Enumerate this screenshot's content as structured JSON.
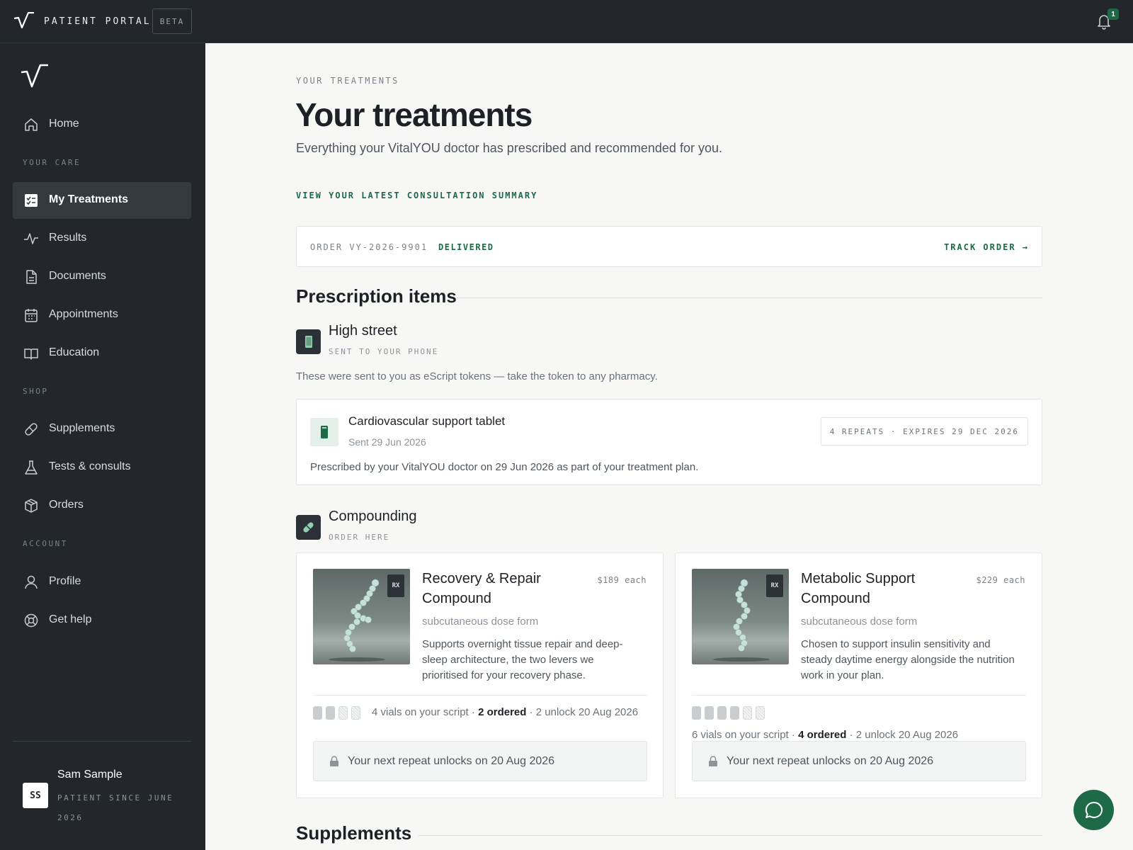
{
  "topbar": {
    "brand": "PATIENT PORTAL",
    "badge": "BETA",
    "notification_count": "1"
  },
  "sidebar": {
    "home": "Home",
    "section_care": "YOUR CARE",
    "care_items": [
      "My Treatments",
      "Results",
      "Documents",
      "Appointments",
      "Education"
    ],
    "section_shop": "SHOP",
    "shop_items": [
      "Supplements",
      "Tests & consults",
      "Orders"
    ],
    "section_account": "ACCOUNT",
    "account_items": [
      "Profile",
      "Get help"
    ],
    "user": {
      "initials": "SS",
      "name": "Sam Sample",
      "since": "PATIENT SINCE JUNE 2026"
    }
  },
  "main": {
    "eyebrow": "YOUR TREATMENTS",
    "title": "Your treatments",
    "subtitle": "Everything your VitalYOU doctor has prescribed and recommended for you.",
    "consult_link": "VIEW YOUR LATEST CONSULTATION SUMMARY",
    "order": {
      "id": "ORDER VY-2026-9901",
      "status": "DELIVERED",
      "track": "TRACK ORDER →"
    },
    "prescription_heading": "Prescription items",
    "high_street": {
      "title": "High street",
      "subtitle": "SENT TO YOUR PHONE",
      "note": "These were sent to you as eScript tokens — take the token to any pharmacy.",
      "item": {
        "name": "Cardiovascular support tablet",
        "sent": "Sent 29 Jun 2026",
        "repeats": "4 REPEATS · EXPIRES 29 DEC 2026",
        "description": "Prescribed by your VitalYOU doctor on 29 Jun 2026 as part of your treatment plan."
      }
    },
    "compounding": {
      "title": "Compounding",
      "subtitle": "ORDER HERE",
      "products": [
        {
          "name": "Recovery & Repair Compound",
          "price": "$189 each",
          "rx_tag": "RX",
          "form": "subcutaneous dose form",
          "description": "Supports overnight tissue repair and deep-sleep architecture, the two levers we prioritised for your recovery phase.",
          "vials_total": 4,
          "vials_ordered": 2,
          "vials_text": "4 vials on your script",
          "ordered_text": "2 ordered",
          "unlock_text": "2 unlock 20 Aug 2026",
          "repeat_note": "Your next repeat unlocks on 20 Aug 2026"
        },
        {
          "name": "Metabolic Support Compound",
          "price": "$229 each",
          "rx_tag": "RX",
          "form": "subcutaneous dose form",
          "description": "Chosen to support insulin sensitivity and steady daytime energy alongside the nutrition work in your plan.",
          "vials_total": 6,
          "vials_ordered": 4,
          "vials_text": "6 vials on your script",
          "ordered_text": "4 ordered",
          "unlock_text": "2 unlock 20 Aug 2026",
          "repeat_note": "Your next repeat unlocks on 20 Aug 2026"
        }
      ]
    },
    "supplements_heading": "Supplements"
  },
  "colors": {
    "accent": "#1e6a47",
    "sidebar_bg": "#23272c",
    "page_bg": "#f7f7f6"
  },
  "icons": {
    "logo": "v-check-logo",
    "bell": "bell-icon",
    "chat": "chat-bubble-icon"
  }
}
